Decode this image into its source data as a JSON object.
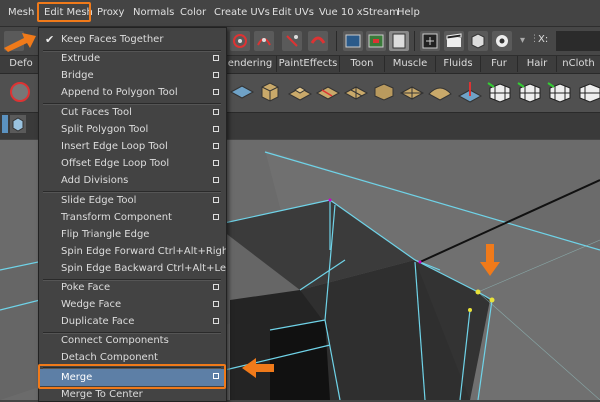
{
  "menubar": {
    "items": [
      "Mesh",
      "Edit Mesh",
      "Proxy",
      "Normals",
      "Color",
      "Create UVs",
      "Edit UVs",
      "Vue 10 xStream",
      "Help"
    ]
  },
  "toolbar": {
    "x_label": "X:"
  },
  "shelf_tabs": [
    "Defo",
    "endering",
    "PaintEffects",
    "Toon",
    "Muscle",
    "Fluids",
    "Fur",
    "Hair",
    "nCloth"
  ],
  "edit_mesh_menu": {
    "items": [
      {
        "label": "Keep Faces Together",
        "checked": true
      },
      {
        "label": "Extrude",
        "option_box": true
      },
      {
        "label": "Bridge",
        "option_box": true
      },
      {
        "label": "Append to Polygon Tool",
        "option_box": true
      },
      {
        "label": "Cut Faces Tool",
        "option_box": true
      },
      {
        "label": "Split Polygon Tool",
        "option_box": true
      },
      {
        "label": "Insert Edge Loop Tool",
        "option_box": true
      },
      {
        "label": "Offset Edge Loop Tool",
        "option_box": true
      },
      {
        "label": "Add Divisions",
        "option_box": true
      },
      {
        "label": "Slide Edge Tool",
        "option_box": true
      },
      {
        "label": "Transform Component",
        "option_box": true
      },
      {
        "label": "Flip Triangle Edge",
        "option_box": false
      },
      {
        "label": "Spin Edge Forward  Ctrl+Alt+Right",
        "option_box": false
      },
      {
        "label": "Spin Edge Backward  Ctrl+Alt+Left",
        "option_box": false
      },
      {
        "label": "Poke Face",
        "option_box": true
      },
      {
        "label": "Wedge Face",
        "option_box": true
      },
      {
        "label": "Duplicate Face",
        "option_box": true
      },
      {
        "label": "Connect Components",
        "option_box": false
      },
      {
        "label": "Detach Component",
        "option_box": false
      },
      {
        "label": "Merge",
        "option_box": true,
        "selected": true
      },
      {
        "label": "Merge To Center",
        "option_box": false
      }
    ]
  },
  "colors": {
    "highlight_orange": "#f07a1a",
    "selected_item": "#5d7fa6",
    "wireframe_cyan": "#6fd3e8",
    "vertex_yellow": "#e8e23a"
  }
}
